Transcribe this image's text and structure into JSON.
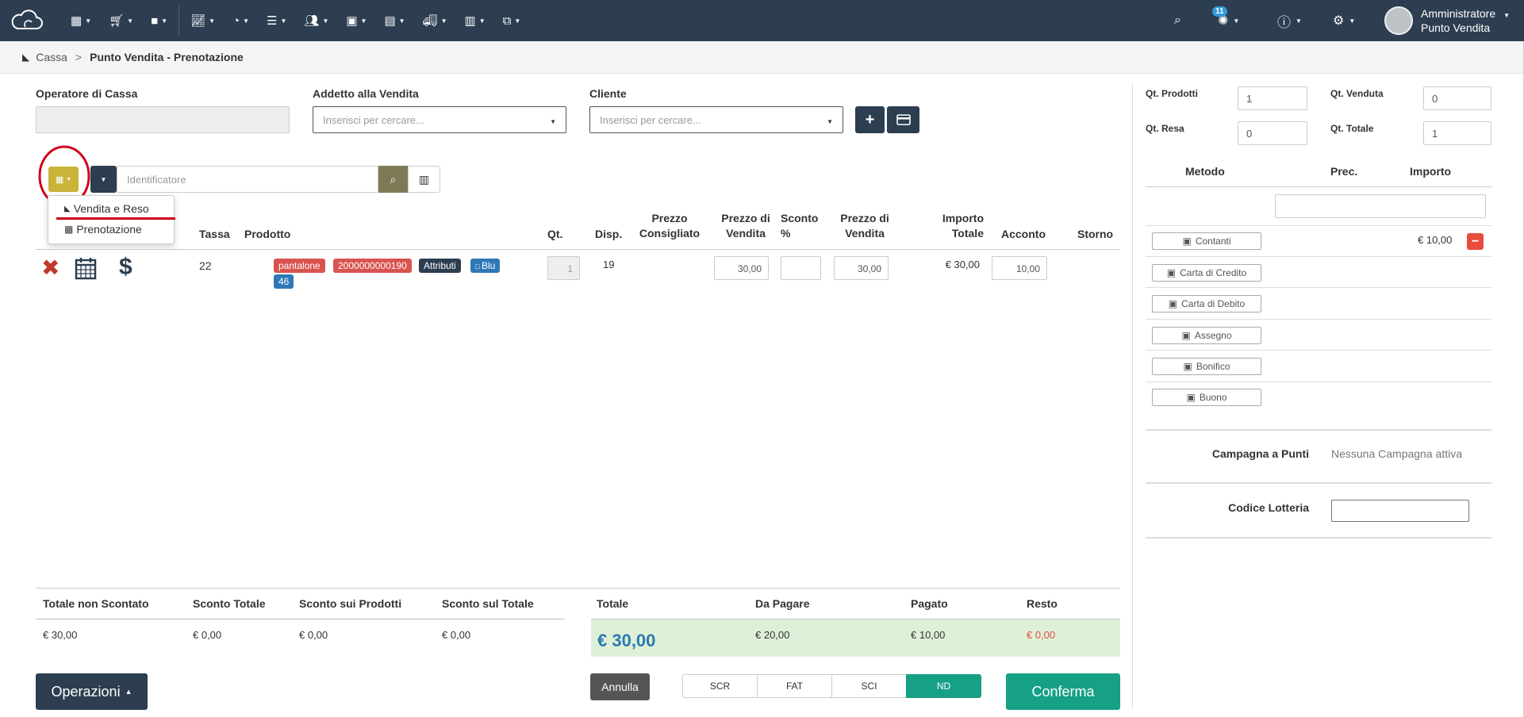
{
  "topbar": {
    "nav_icons": [
      "dashboard-icon",
      "cart-icon",
      "briefcase-icon",
      "chart-icon",
      "gauge-icon",
      "list-icon",
      "users-icon",
      "money-icon",
      "document-icon",
      "truck-icon",
      "barcode-icon",
      "copy-icon"
    ],
    "notification_count": "11",
    "user_name": "Amministratore",
    "user_role": "Punto Vendita"
  },
  "breadcrumb": {
    "home": "Cassa",
    "separator": ">",
    "current": "Punto Vendita - Prenotazione"
  },
  "form": {
    "operatore_label": "Operatore di Cassa",
    "addetto_label": "Addetto alla Vendita",
    "addetto_placeholder": "Inserisci per cercare...",
    "cliente_label": "Cliente",
    "cliente_placeholder": "Inserisci per cercare...",
    "identificatore_placeholder": "Identificatore"
  },
  "mode_menu": {
    "items": [
      "Vendita e Reso",
      "Prenotazione"
    ]
  },
  "table": {
    "headers": {
      "tassa": "Tassa",
      "prodotto": "Prodotto",
      "qt": "Qt.",
      "disp": "Disp.",
      "prezzo_consigliato_1": "Prezzo",
      "prezzo_consigliato_2": "Consigliato",
      "prezzo_vendita_1": "Prezzo di",
      "prezzo_vendita_2": "Vendita",
      "sconto_1": "Sconto",
      "sconto_2": "%",
      "prezzo_vendita_b1": "Prezzo di",
      "prezzo_vendita_b2": "Vendita",
      "importo_1": "Importo",
      "importo_2": "Totale",
      "acconto": "Acconto",
      "storno": "Storno"
    },
    "rows": [
      {
        "tassa": "22",
        "tags": [
          "pantalone",
          "2000000000190",
          "Attributi",
          "Blu",
          "46"
        ],
        "qt": "1",
        "disp": "19",
        "prezzo_vendita": "30,00",
        "sconto": "",
        "prezzo_vendita_2": "30,00",
        "importo": "€ 30,00",
        "acconto": "10,00"
      }
    ]
  },
  "summary_left": {
    "headers": [
      "Totale non Scontato",
      "Sconto Totale",
      "Sconto sui Prodotti",
      "Sconto sul Totale"
    ],
    "values": [
      "€ 30,00",
      "€ 0,00",
      "€ 0,00",
      "€ 0,00"
    ]
  },
  "summary_right": {
    "headers": [
      "Totale",
      "Da Pagare",
      "Pagato",
      "Resto"
    ],
    "values": [
      "€ 30,00",
      "€ 20,00",
      "€ 10,00",
      "€ 0,00"
    ]
  },
  "bottom": {
    "operazioni": "Operazioni",
    "annulla": "Annulla",
    "segments": [
      "SCR",
      "FAT",
      "SCI",
      "ND"
    ],
    "conferma": "Conferma"
  },
  "right_panel": {
    "qt_prodotti_label": "Qt. Prodotti",
    "qt_prodotti": "1",
    "qt_venduta_label": "Qt. Venduta",
    "qt_venduta": "0",
    "qt_resa_label": "Qt. Resa",
    "qt_resa": "0",
    "qt_totale_label": "Qt. Totale",
    "qt_totale": "1",
    "col_metodo": "Metodo",
    "col_prec": "Prec.",
    "col_importo": "Importo",
    "methods": [
      "Contanti",
      "Carta di Credito",
      "Carta di Debito",
      "Assegno",
      "Bonifico",
      "Buono"
    ],
    "contanti_importo": "€ 10,00",
    "campagna_label": "Campagna a Punti",
    "campagna_value": "Nessuna Campagna attiva",
    "lotteria_label": "Codice Lotteria"
  },
  "colors": {
    "topbar": "#2c3e50",
    "accent_yellow": "#c9b338",
    "danger": "#e74c3c",
    "success": "#16a085",
    "totals_bg": "#dff0d8",
    "total_blue": "#2a7ab0",
    "highlight_circle": "#d0021b"
  }
}
